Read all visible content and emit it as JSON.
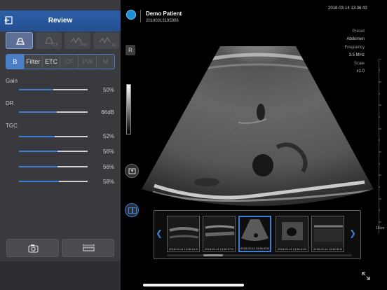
{
  "left_panel": {
    "title": "Review",
    "mode_row1": [
      {
        "label": "",
        "icon": "b-mode-icon",
        "active": true
      },
      {
        "label": "CF",
        "icon": "color-flow-icon",
        "active": false
      },
      {
        "label": "PW",
        "icon": "pulse-wave-icon",
        "active": false
      },
      {
        "label": "M",
        "icon": "m-mode-icon",
        "active": false
      }
    ],
    "mode_row2": [
      {
        "label": "B",
        "active": true,
        "disabled": false
      },
      {
        "label": "Filter",
        "active": false,
        "disabled": false
      },
      {
        "label": "ETC",
        "active": false,
        "disabled": false
      },
      {
        "label": "CF",
        "active": false,
        "disabled": true
      },
      {
        "label": "PW",
        "active": false,
        "disabled": true
      },
      {
        "label": "M",
        "active": false,
        "disabled": true
      }
    ],
    "params": {
      "gain_label": "Gain",
      "gain_value": "50%",
      "gain_level": 0.5,
      "dr_label": "DR",
      "dr_value": "66dB",
      "dr_level": 0.55,
      "tgc_label": "TGC",
      "tgc_values": [
        "52%",
        "56%",
        "56%",
        "58%"
      ],
      "tgc_levels": [
        0.52,
        0.56,
        0.56,
        0.58
      ]
    },
    "buttons": {
      "capture_icon": "camera-icon",
      "measure_icon": "ruler-icon"
    },
    "colors": {
      "accent": "#3d7fd6",
      "header": "#2c5fa8",
      "panel": "#3a3a3e"
    }
  },
  "patient": {
    "name": "Demo Patient",
    "id": "20180313195906",
    "datetime": "2018-03-14 13:36:43"
  },
  "imaging_info": {
    "preset_label": "Preset",
    "preset_value": "Abdomen",
    "frequency_label": "Frequency",
    "frequency_value": "3.5 MHz",
    "scale_label": "Scale",
    "scale_value": "x1.0"
  },
  "controls": {
    "orientation_label": "R",
    "depth_label": "15cm"
  },
  "thumbnails": [
    {
      "label": "2018-03-14 13:36:41 B",
      "selected": false
    },
    {
      "label": "2018-03-14 13:36:37 B",
      "selected": false
    },
    {
      "label": "2018-03-14 13:36:43 B",
      "selected": true
    },
    {
      "label": "2018-03-14 13:36:41 B",
      "selected": false
    },
    {
      "label": "2018-03-14 13:36:39 B",
      "selected": false
    }
  ]
}
